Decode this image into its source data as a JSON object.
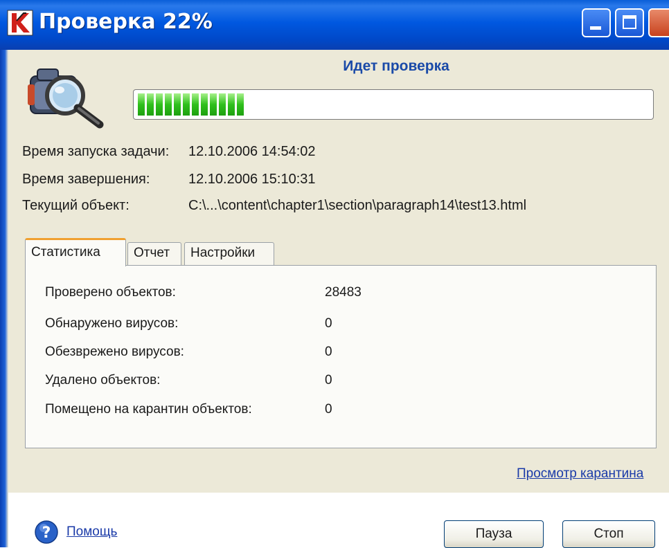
{
  "window": {
    "title": "Проверка 22%"
  },
  "header": {
    "status_text": "Идет проверка",
    "progress_fraction": 0.22,
    "progress_color": "#2fc01c"
  },
  "info": {
    "start_label": "Время запуска задачи:",
    "start_value": "12.10.2006 14:54:02",
    "end_label": "Время завершения:",
    "end_value": "12.10.2006 15:10:31",
    "current_label": "Текущий объект:",
    "current_value": "C:\\...\\content\\chapter1\\section\\paragraph14\\test13.html"
  },
  "tabs": [
    {
      "label": "Статистика",
      "active": true
    },
    {
      "label": "Отчет",
      "active": false
    },
    {
      "label": "Настройки",
      "active": false
    }
  ],
  "stats": [
    {
      "label": "Проверено объектов:",
      "value": "28483"
    },
    {
      "label": "Обнаружено вирусов:",
      "value": "0"
    },
    {
      "label": "Обезврежено вирусов:",
      "value": "0"
    },
    {
      "label": "Удалено объектов:",
      "value": "0"
    },
    {
      "label": "Помещено на карантин объектов:",
      "value": "0"
    }
  ],
  "links": {
    "quarantine": "Просмотр карантина",
    "help": "Помощь"
  },
  "buttons": {
    "pause": "Пауза",
    "stop": "Стоп"
  },
  "icons": {
    "app": "kaspersky-k-icon",
    "scan": "camera-magnifier-icon",
    "help": "question-help-icon"
  }
}
